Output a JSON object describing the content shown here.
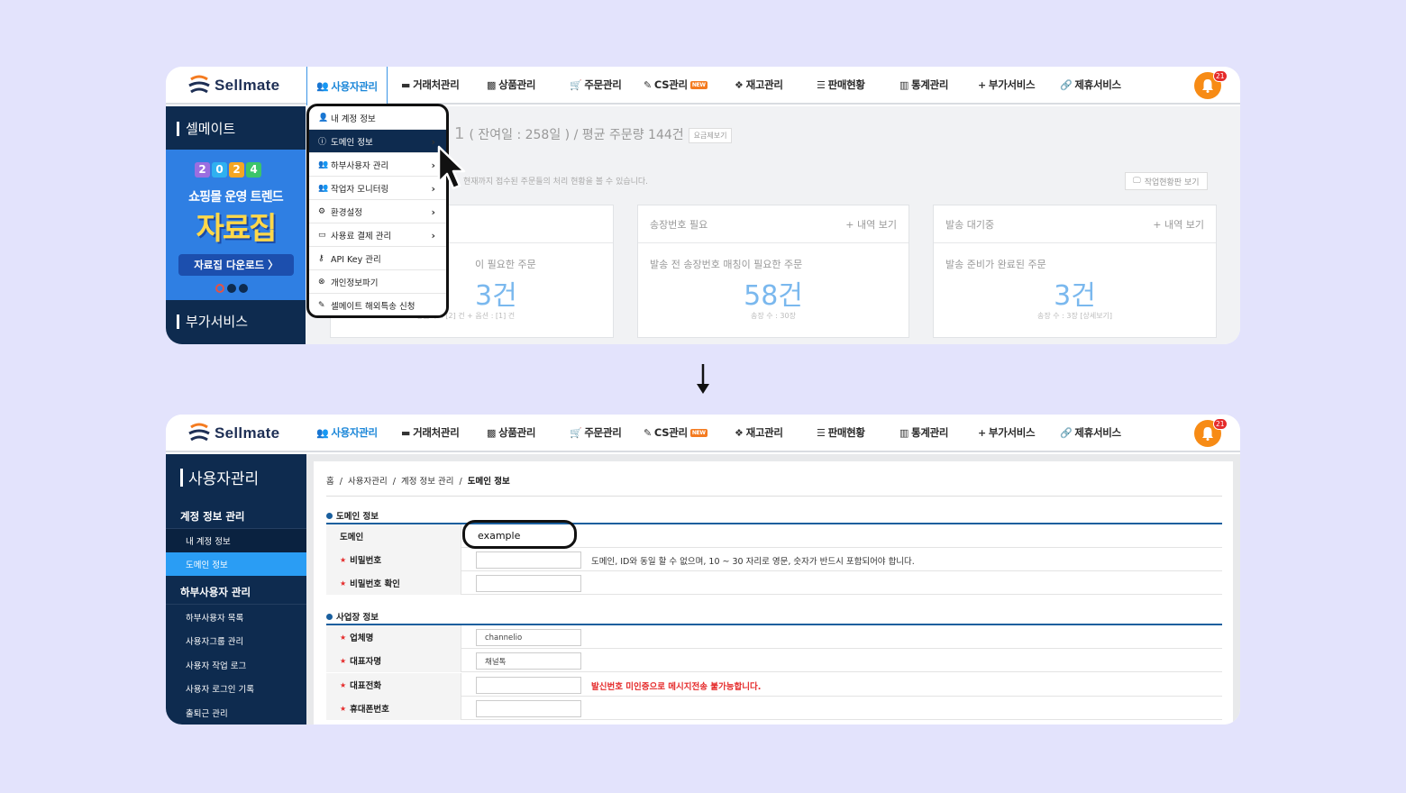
{
  "brand": {
    "name": "Sellmate"
  },
  "nav": [
    {
      "label": "사용자관리",
      "icon": "users-icon",
      "glyph": "👥"
    },
    {
      "label": "거래처관리",
      "icon": "briefcase-icon",
      "glyph": "▬"
    },
    {
      "label": "상품관리",
      "icon": "box-icon",
      "glyph": "▩"
    },
    {
      "label": "주문관리",
      "icon": "cart-icon",
      "glyph": "🛒"
    },
    {
      "label": "CS관리",
      "icon": "edit-icon",
      "glyph": "✎",
      "badge": "NEW"
    },
    {
      "label": "재고관리",
      "icon": "cubes-icon",
      "glyph": "❖"
    },
    {
      "label": "판매현황",
      "icon": "list-icon",
      "glyph": "☰"
    },
    {
      "label": "통계관리",
      "icon": "bar-chart-icon",
      "glyph": "▥"
    },
    {
      "label": "부가서비스",
      "icon": "plus-icon",
      "glyph": "+"
    },
    {
      "label": "제휴서비스",
      "icon": "link-icon",
      "glyph": "🔗"
    }
  ],
  "notifications": {
    "count": "21"
  },
  "screen1": {
    "sidebar": {
      "title": "셀메이트",
      "second_title": "부가서비스"
    },
    "banner": {
      "year": [
        "2",
        "0",
        "2",
        "4"
      ],
      "line1": "쇼핑몰 운영 트렌드",
      "line2": "자료집",
      "button": "자료집 다운로드  〉"
    },
    "summary": {
      "big": "1",
      "text": "( 잔여일 : 258일 ) / 평균 주문량 144건",
      "button": "요금제보기"
    },
    "subdesc": "현재까지 접수된 주문들의 처리 현황을 볼 수 있습니다.",
    "status_button": "작업현황판 보기",
    "cards": [
      {
        "title": "",
        "link": "",
        "sub": "이 필요한 주문",
        "value": "3건",
        "note": "상품 수 : [2] 건 + 옵션 : [1] 건"
      },
      {
        "title": "송장번호 필요",
        "link": "+ 내역 보기",
        "sub": "발송 전 송장번호 매칭이 필요한 주문",
        "value": "58건",
        "note": "송장 수 : 30장"
      },
      {
        "title": "발송 대기중",
        "link": "+ 내역 보기",
        "sub": "발송 준비가 완료된 주문",
        "value": "3건",
        "note": "송장 수 : 3장 [상세보기]"
      }
    ],
    "dropdown": [
      {
        "label": "내 계정 정보",
        "icon": "user-edit-icon",
        "glyph": "👤",
        "chevron": false
      },
      {
        "label": "도메인 정보",
        "icon": "info-icon",
        "glyph": "ⓘ",
        "chevron": true,
        "selected": true
      },
      {
        "label": "하부사용자 관리",
        "icon": "users-icon",
        "glyph": "👥",
        "chevron": true
      },
      {
        "label": "작업자 모니터링",
        "icon": "users-icon",
        "glyph": "👥",
        "chevron": true
      },
      {
        "label": "환경설정",
        "icon": "gears-icon",
        "glyph": "⚙",
        "chevron": true
      },
      {
        "label": "사용료 결제 관리",
        "icon": "credit-card-icon",
        "glyph": "▭",
        "chevron": true
      },
      {
        "label": "API Key 관리",
        "icon": "key-icon",
        "glyph": "⚷",
        "chevron": false
      },
      {
        "label": "개인정보파기",
        "icon": "close-circle-icon",
        "glyph": "⊗",
        "chevron": false
      },
      {
        "label": "셀메이트 해외특송 신청",
        "icon": "edit-icon",
        "glyph": "✎",
        "chevron": false
      }
    ]
  },
  "screen2": {
    "sidebar": {
      "title": "사용자관리",
      "groups": [
        {
          "label": "계정 정보 관리",
          "items": [
            {
              "label": "내 계정 정보"
            },
            {
              "label": "도메인 정보",
              "selected": true
            }
          ]
        },
        {
          "label": "하부사용자 관리",
          "items": [
            {
              "label": "하부사용자 목록"
            },
            {
              "label": "사용자그룹 관리"
            },
            {
              "label": "사용자 작업 로그"
            },
            {
              "label": "사용자 로그인 기록"
            },
            {
              "label": "출퇴근 관리"
            }
          ]
        }
      ]
    },
    "breadcrumb": [
      "홈",
      "사용자관리",
      "계정 정보 관리",
      "도메인 정보"
    ],
    "domain_section": {
      "title": "도메인 정보",
      "fields": [
        {
          "label": "도메인",
          "value": "example",
          "required": false
        },
        {
          "label": "비밀번호",
          "value": "",
          "required": true,
          "help": "도메인, ID와 동일 할 수 없으며, 10 ~ 30 자리로 영문, 숫자가 반드시 포함되어야 합니다."
        },
        {
          "label": "비밀번호 확인",
          "value": "",
          "required": true
        }
      ]
    },
    "business_section": {
      "title": "사업장 정보",
      "fields": [
        {
          "label": "업체명",
          "value": "channelio",
          "required": true
        },
        {
          "label": "대표자명",
          "value": "채널톡",
          "required": true
        },
        {
          "label": "대표전화",
          "value": "",
          "required": true,
          "warn": "발신번호 미인증으로 메시지전송 불가능합니다."
        },
        {
          "label": "휴대폰번호",
          "value": "",
          "required": true
        }
      ]
    }
  }
}
